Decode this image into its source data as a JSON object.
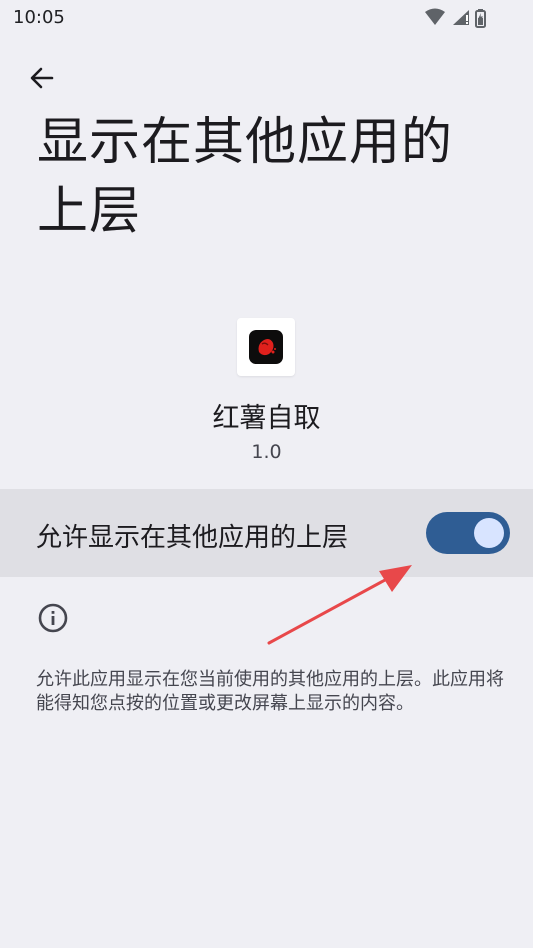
{
  "status_bar": {
    "time": "10:05",
    "icons": [
      "wifi-icon",
      "signal-icon",
      "battery-icon"
    ]
  },
  "header": {
    "back_icon": "arrow-left-icon",
    "title": "显示在其他应用的上层"
  },
  "app": {
    "name": "红薯自取",
    "version": "1.0",
    "icon_colors": {
      "background": "#0d0c0c",
      "accent": "#e0201c"
    }
  },
  "permission": {
    "label": "允许显示在其他应用的上层",
    "enabled": true,
    "switch_track_color": "#2f5d94",
    "switch_thumb_color": "#d8e4ff"
  },
  "info": {
    "icon": "info-icon",
    "description": "允许此应用显示在您当前使用的其他应用的上层。此应用将能得知您点按的位置或更改屏幕上显示的内容。"
  },
  "annotation": {
    "arrow_color": "#e8484a"
  }
}
